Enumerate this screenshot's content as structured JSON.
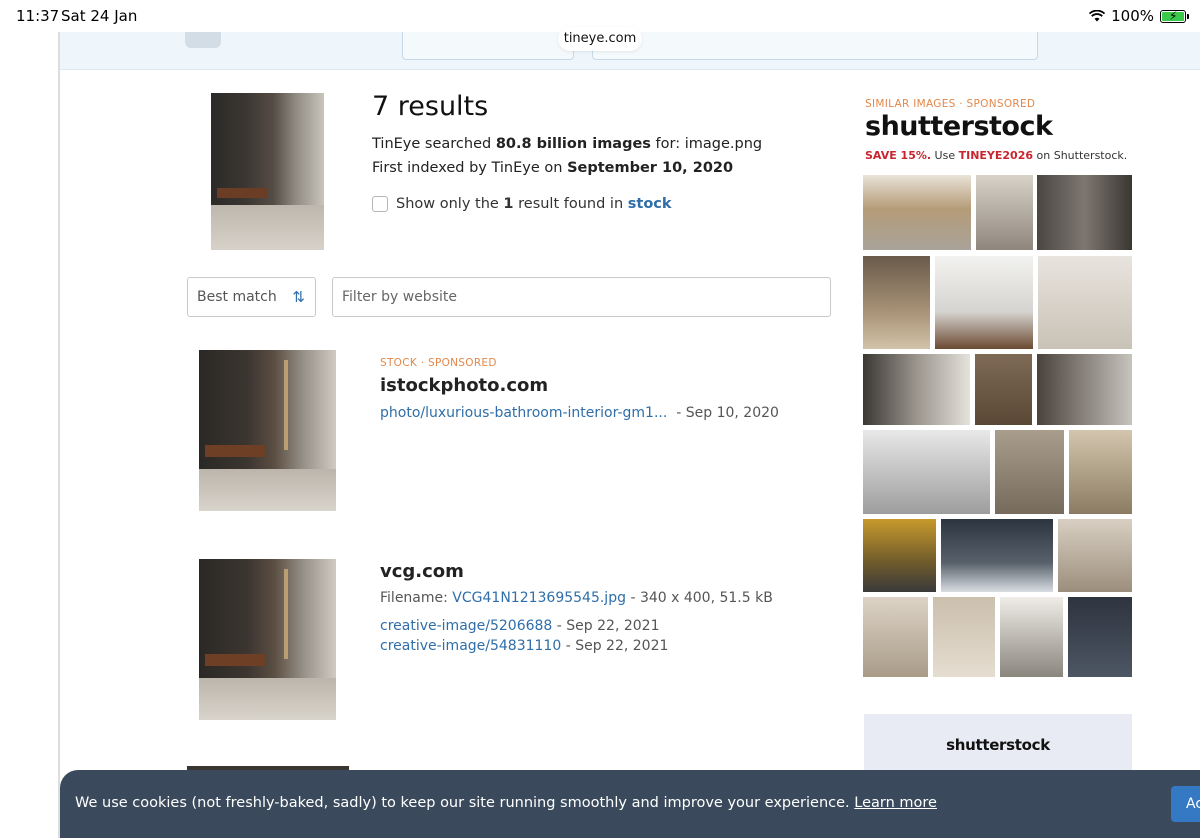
{
  "status": {
    "time": "11:37",
    "date": "Sat 24 Jan",
    "battery": "100%",
    "battery_level": 1.0
  },
  "browser": {
    "url": "tineye.com"
  },
  "query": {
    "title": "7 results",
    "searched_prefix": "TinEye searched ",
    "searched_count": "80.8 billion images",
    "searched_mid": " for: ",
    "searched_file": "image.png",
    "indexed_prefix": "First indexed by TinEye on ",
    "indexed_date": "September 10, 2020",
    "stock_prefix": "Show only the ",
    "stock_count": "1",
    "stock_mid": " result found in ",
    "stock_link": "stock"
  },
  "filters": {
    "sort_label": "Best match",
    "website_placeholder": "Filter by website"
  },
  "results": [
    {
      "tag": "STOCK",
      "sponsored": "SPONSORED",
      "site": "istockphoto.com",
      "links": [
        {
          "text": "photo/luxurious-bathroom-interior-gm1...",
          "date": "- Sep 10, 2020"
        }
      ]
    },
    {
      "site": "vcg.com",
      "filename_label": "Filename: ",
      "filename": "VCG41N1213695545.jpg",
      "filename_meta": "- 340 x 400, 51.5 kB",
      "links": [
        {
          "text": "creative-image/5206688",
          "date": "- Sep 22, 2021"
        },
        {
          "text": "creative-image/54831110",
          "date": "- Sep 22, 2021"
        }
      ]
    }
  ],
  "ad": {
    "label": "SIMILAR IMAGES",
    "sponsored": "SPONSORED",
    "brand": "shutterstock",
    "promo_save": "SAVE 15%.",
    "promo_mid": " Use ",
    "promo_code": "TINEYE2026",
    "promo_end": " on Shutterstock.",
    "banner_brand": "shutterstock"
  },
  "cookie": {
    "message": "We use cookies (not freshly-baked, sadly) to keep our site running smoothly and improve your experience.",
    "learn_more": "Learn more",
    "accept": "Ac"
  },
  "colors": {
    "link": "#2f6ea8",
    "accent_orange": "#e3874a",
    "promo_red": "#c8262f",
    "cookie_bg": "#3a4a5c",
    "accept_blue": "#3579c4"
  }
}
